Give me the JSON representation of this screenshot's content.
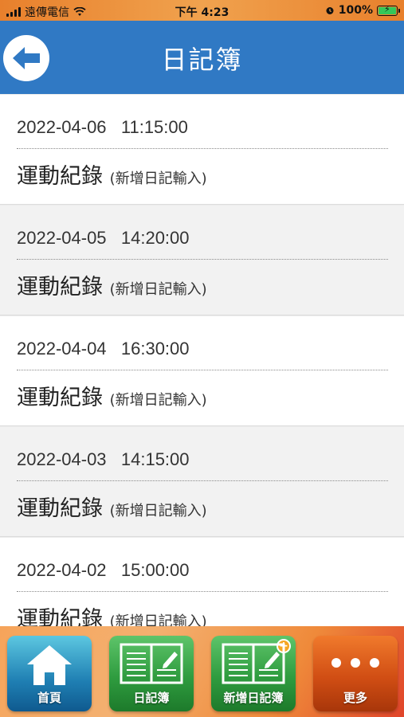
{
  "status_bar": {
    "carrier": "遠傳電信",
    "time": "下午 4:23",
    "battery": "100%"
  },
  "header": {
    "title": "日記簿"
  },
  "entries": [
    {
      "datetime": "2022-04-06   11:15:00",
      "title": "運動紀錄",
      "subtitle": "(新增日記輸入)"
    },
    {
      "datetime": "2022-04-05   14:20:00",
      "title": "運動紀錄",
      "subtitle": "(新增日記輸入)"
    },
    {
      "datetime": "2022-04-04   16:30:00",
      "title": "運動紀錄",
      "subtitle": "(新增日記輸入)"
    },
    {
      "datetime": "2022-04-03   14:15:00",
      "title": "運動紀錄",
      "subtitle": "(新增日記輸入)"
    },
    {
      "datetime": "2022-04-02   15:00:00",
      "title": "運動紀錄",
      "subtitle": "(新增日記輸入)"
    }
  ],
  "tabs": [
    {
      "label": "首頁",
      "icon": "home-icon"
    },
    {
      "label": "日記簿",
      "icon": "notebook-icon"
    },
    {
      "label": "新增日記簿",
      "icon": "notebook-add-icon"
    },
    {
      "label": "更多",
      "icon": "more-icon"
    }
  ],
  "colors": {
    "header": "#3079c4",
    "status_bar": "#e8802c",
    "tab_home": "#1f7fb3",
    "tab_diary": "#2f9c3f",
    "tab_more": "#d14e14"
  }
}
